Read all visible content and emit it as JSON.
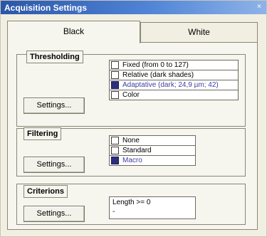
{
  "window": {
    "title": "Acquisition Settings",
    "close_symbol": "×"
  },
  "tabs": [
    {
      "label": "Black",
      "active": true
    },
    {
      "label": "White",
      "active": false
    }
  ],
  "thresholding": {
    "title": "Thresholding",
    "button": "Settings...",
    "options": [
      {
        "label": "Fixed (from 0 to 127)",
        "checked": false
      },
      {
        "label": "Relative (dark shades)",
        "checked": false
      },
      {
        "label": "Adaptative (dark; 24,9 µm; 42)",
        "checked": true
      },
      {
        "label": "Color",
        "checked": false
      }
    ]
  },
  "filtering": {
    "title": "Filtering",
    "button": "Settings...",
    "options": [
      {
        "label": "None",
        "checked": false
      },
      {
        "label": "Standard",
        "checked": false
      },
      {
        "label": "Macro",
        "checked": true
      }
    ]
  },
  "criterions": {
    "title": "Criterions",
    "button": "Settings...",
    "lines": [
      "Length >= 0",
      "-"
    ]
  },
  "colors": {
    "titlebar": "#2b56a8",
    "selected_box": "#2c2f7e",
    "selected_text": "#3b3ea3"
  }
}
